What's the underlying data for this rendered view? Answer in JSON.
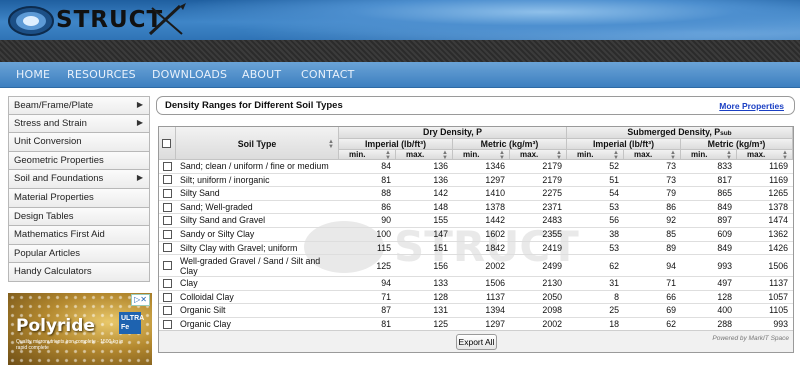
{
  "header": {
    "logo_text": "STRUCT",
    "brand_color": "#2f73b6"
  },
  "nav": {
    "items": [
      "HOME",
      "RESOURCES",
      "DOWNLOADS",
      "ABOUT",
      "CONTACT"
    ]
  },
  "sidebar": {
    "items": [
      {
        "label": "Beam/Frame/Plate",
        "has_submenu": true
      },
      {
        "label": "Stress and Strain",
        "has_submenu": true
      },
      {
        "label": "Unit Conversion",
        "has_submenu": false
      },
      {
        "label": "Geometric Properties",
        "has_submenu": false
      },
      {
        "label": "Soil and Foundations",
        "has_submenu": true
      },
      {
        "label": "Material Properties",
        "has_submenu": false
      },
      {
        "label": "Design Tables",
        "has_submenu": false
      },
      {
        "label": "Mathematics First Aid",
        "has_submenu": false
      },
      {
        "label": "Popular Articles",
        "has_submenu": false
      },
      {
        "label": "Handy Calculators",
        "has_submenu": false
      }
    ]
  },
  "ad": {
    "title": "Polyride",
    "badge": "ULTRA Fe",
    "subtitle": "Quality micronutrients iron complete · 1500 kg in rapid complete"
  },
  "panel": {
    "title": "Density Ranges for Different Soil Types",
    "more_link": "More Properties"
  },
  "table": {
    "col_soil": "Soil Type",
    "group_dry": "Dry Density, P",
    "group_sub": "Submerged Density, P",
    "group_sub_subscript": "sub",
    "imperial": "Imperial (lb/ft³)",
    "metric": "Metric (kg/m³)",
    "min": "min.",
    "max": "max.",
    "rows": [
      {
        "soil": "Sand; clean / uniform / fine or medium",
        "vals": [
          "84",
          "136",
          "1346",
          "2179",
          "52",
          "73",
          "833",
          "1169"
        ]
      },
      {
        "soil": "Silt; uniform / inorganic",
        "vals": [
          "81",
          "136",
          "1297",
          "2179",
          "51",
          "73",
          "817",
          "1169"
        ]
      },
      {
        "soil": "Silty Sand",
        "vals": [
          "88",
          "142",
          "1410",
          "2275",
          "54",
          "79",
          "865",
          "1265"
        ]
      },
      {
        "soil": "Sand; Well-graded",
        "vals": [
          "86",
          "148",
          "1378",
          "2371",
          "53",
          "86",
          "849",
          "1378"
        ]
      },
      {
        "soil": "Silty Sand and Gravel",
        "vals": [
          "90",
          "155",
          "1442",
          "2483",
          "56",
          "92",
          "897",
          "1474"
        ]
      },
      {
        "soil": "Sandy or Silty Clay",
        "vals": [
          "100",
          "147",
          "1602",
          "2355",
          "38",
          "85",
          "609",
          "1362"
        ]
      },
      {
        "soil": "Silty Clay with Gravel; uniform",
        "vals": [
          "115",
          "151",
          "1842",
          "2419",
          "53",
          "89",
          "849",
          "1426"
        ]
      },
      {
        "soil": "Well-graded Gravel / Sand / Silt and Clay",
        "vals": [
          "125",
          "156",
          "2002",
          "2499",
          "62",
          "94",
          "993",
          "1506"
        ]
      },
      {
        "soil": "Clay",
        "vals": [
          "94",
          "133",
          "1506",
          "2130",
          "31",
          "71",
          "497",
          "1137"
        ]
      },
      {
        "soil": "Colloidal Clay",
        "vals": [
          "71",
          "128",
          "1137",
          "2050",
          "8",
          "66",
          "128",
          "1057"
        ]
      },
      {
        "soil": "Organic Silt",
        "vals": [
          "87",
          "131",
          "1394",
          "2098",
          "25",
          "69",
          "400",
          "1105"
        ]
      },
      {
        "soil": "Organic Clay",
        "vals": [
          "81",
          "125",
          "1297",
          "2002",
          "18",
          "62",
          "288",
          "993"
        ]
      }
    ],
    "export_label": "Export All",
    "powered_by": "Powered by MarkIT Space"
  }
}
